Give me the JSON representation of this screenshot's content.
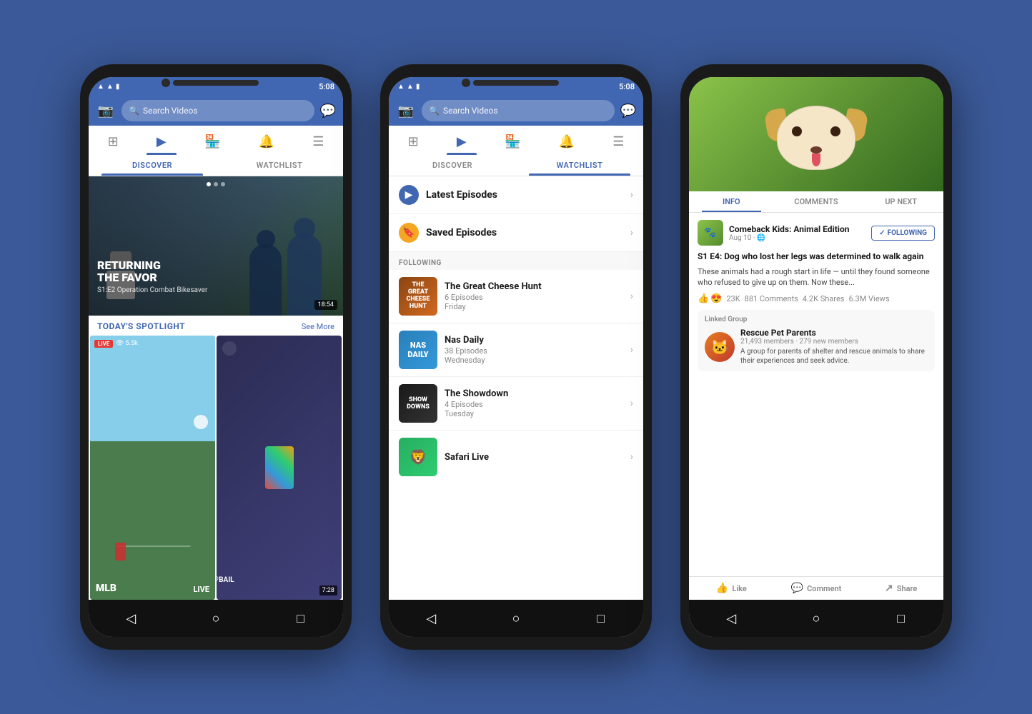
{
  "background": "#3b5998",
  "phones": [
    {
      "id": "phone1",
      "statusBar": {
        "time": "5:08",
        "icons": [
          "wifi",
          "signal",
          "battery"
        ]
      },
      "topBar": {
        "cameraIcon": "📷",
        "searchPlaceholder": "Search Videos",
        "messengerIcon": "💬"
      },
      "navIcons": [
        {
          "icon": "⊞",
          "label": "feed",
          "active": false
        },
        {
          "icon": "▶",
          "label": "watch",
          "active": true
        },
        {
          "icon": "🏪",
          "label": "marketplace",
          "active": false
        },
        {
          "icon": "🔔",
          "label": "notifications",
          "active": false
        },
        {
          "icon": "☰",
          "label": "menu",
          "active": false
        }
      ],
      "tabs": [
        {
          "label": "DISCOVER",
          "active": true
        },
        {
          "label": "WATCHLIST",
          "active": false
        }
      ],
      "hero": {
        "title": "RETURNING\nTHE FAVOR",
        "subtitle": "S1:E2 Operation Combat Bikesaver",
        "duration": "18:54"
      },
      "spotlight": {
        "title": "TODAY'S SPOTLIGHT",
        "seeMore": "See More",
        "items": [
          {
            "type": "live",
            "views": "5.5k",
            "logo": "MLB",
            "label": "LIVE"
          },
          {
            "type": "video",
            "title": "BAE♡BAIL",
            "duration": "7:28"
          }
        ]
      },
      "navBar": [
        "◁",
        "○",
        "□"
      ]
    },
    {
      "id": "phone2",
      "statusBar": {
        "time": "5:08",
        "icons": [
          "wifi",
          "signal",
          "battery"
        ]
      },
      "topBar": {
        "cameraIcon": "📷",
        "searchPlaceholder": "Search Videos",
        "messengerIcon": "💬"
      },
      "navIcons": [
        {
          "icon": "⊞",
          "label": "feed",
          "active": false
        },
        {
          "icon": "▶",
          "label": "watch",
          "active": true
        },
        {
          "icon": "🏪",
          "label": "marketplace",
          "active": false
        },
        {
          "icon": "🔔",
          "label": "notifications",
          "active": false
        },
        {
          "icon": "☰",
          "label": "menu",
          "active": false
        }
      ],
      "tabs": [
        {
          "label": "DISCOVER",
          "active": false
        },
        {
          "label": "WATCHLIST",
          "active": true
        }
      ],
      "episodes": [
        {
          "type": "play",
          "label": "Latest Episodes"
        },
        {
          "type": "bookmark",
          "label": "Saved Episodes"
        }
      ],
      "followingLabel": "FOLLOWING",
      "shows": [
        {
          "name": "The Great Cheese Hunt",
          "meta": "6 Episodes\nFriday",
          "thumbType": "cheese",
          "thumbText": "THE\nGREAT\nCHEESE\nHUNT"
        },
        {
          "name": "Nas Daily",
          "meta": "38 Episodes\nWednesday",
          "thumbType": "nas",
          "thumbText": "NAS"
        },
        {
          "name": "The Showdown",
          "meta": "4 Episodes\nTuesday",
          "thumbType": "showdown",
          "thumbText": "SHOW\nDOWNS"
        },
        {
          "name": "Safari Live",
          "meta": "",
          "thumbType": "safari",
          "thumbText": "🦁"
        }
      ],
      "navBar": [
        "◁",
        "○",
        "□"
      ]
    },
    {
      "id": "phone3",
      "infoTabs": [
        {
          "label": "INFO",
          "active": true
        },
        {
          "label": "COMMENTS",
          "active": false
        },
        {
          "label": "UP NEXT",
          "active": false
        }
      ],
      "post": {
        "pageName": "Comeback Kids: Animal Edition",
        "date": "Aug 10 · 🌐",
        "followingBtn": "✓ FOLLOWING",
        "title": "S1 E4: Dog who lost her legs was determined to walk again",
        "body": "These animals had a rough start in life — until they found someone who refused to give up on them. Now these...",
        "reactions": {
          "icons": [
            "👍",
            "😍"
          ],
          "count": "23K",
          "comments": "881 Comments",
          "shares": "4.2K Shares",
          "views": "6.3M Views"
        }
      },
      "linkedGroup": {
        "label": "Linked Group",
        "name": "Rescue Pet Parents",
        "members": "21,493 members · 279 new members",
        "description": "A group for parents of shelter and rescue animals to share their experiences and seek advice.",
        "avatarIcon": "🐱"
      },
      "actions": [
        {
          "icon": "👍",
          "label": "Like"
        },
        {
          "icon": "💬",
          "label": "Comment"
        },
        {
          "icon": "↗",
          "label": "Share"
        }
      ],
      "navBar": [
        "◁",
        "○",
        "□"
      ]
    }
  ]
}
